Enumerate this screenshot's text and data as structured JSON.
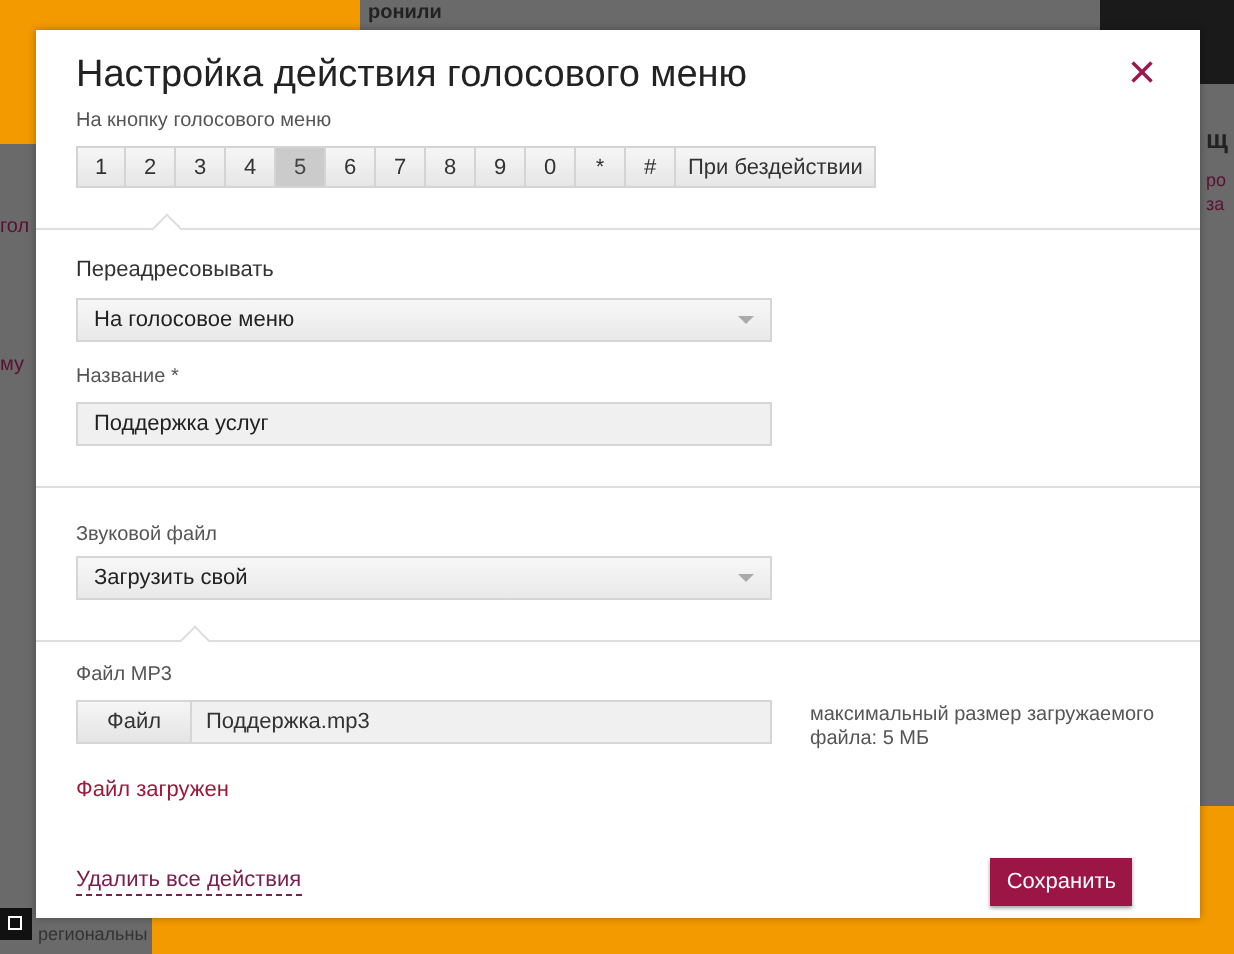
{
  "background": {
    "fragments": [
      {
        "text": "ронили",
        "kind": "top"
      },
      {
        "text": "гол",
        "kind": "left1"
      },
      {
        "text": "му",
        "kind": "left2"
      },
      {
        "text": "щ",
        "kind": "right1"
      },
      {
        "text": "ро",
        "kind": "right2"
      },
      {
        "text": "за",
        "kind": "right3"
      },
      {
        "text": "региональны",
        "kind": "bottom"
      }
    ]
  },
  "dialog": {
    "title": "Настройка действия голосового меню",
    "close": "×",
    "keys_label": "На кнопку голосового меню",
    "keys": [
      {
        "label": "1",
        "selected": false
      },
      {
        "label": "2",
        "selected": false
      },
      {
        "label": "3",
        "selected": false
      },
      {
        "label": "4",
        "selected": false
      },
      {
        "label": "5",
        "selected": true
      },
      {
        "label": "6",
        "selected": false
      },
      {
        "label": "7",
        "selected": false
      },
      {
        "label": "8",
        "selected": false
      },
      {
        "label": "9",
        "selected": false
      },
      {
        "label": "0",
        "selected": false
      },
      {
        "label": "*",
        "selected": false
      },
      {
        "label": "#",
        "selected": false
      },
      {
        "label": "При бездействии",
        "selected": false
      }
    ],
    "redirect": {
      "label": "Переадресовывать",
      "value": "На голосовое меню"
    },
    "name": {
      "label": "Название *",
      "value": "Поддержка услуг"
    },
    "sound": {
      "label": "Звуковой файл",
      "value": "Загрузить свой"
    },
    "mp3": {
      "label": "Файл MP3",
      "button": "Файл",
      "value": "Поддержка.mp3",
      "hint": "максимальный размер загружаемого файла: 5 МБ",
      "status": "Файл загружен"
    },
    "delete_link": "Удалить все действия",
    "save": "Сохранить"
  }
}
